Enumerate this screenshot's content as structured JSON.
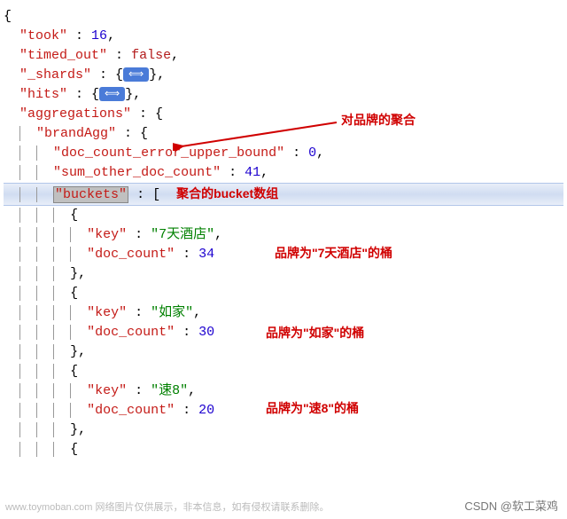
{
  "json": {
    "took_key": "\"took\"",
    "took_val": "16",
    "timed_out_key": "\"timed_out\"",
    "timed_out_val": "false",
    "shards_key": "\"_shards\"",
    "hits_key": "\"hits\"",
    "aggregations_key": "\"aggregations\"",
    "brandAgg_key": "\"brandAgg\"",
    "doc_count_error_key": "\"doc_count_error_upper_bound\"",
    "doc_count_error_val": "0",
    "sum_other_key": "\"sum_other_doc_count\"",
    "sum_other_val": "41",
    "buckets_key": "\"buckets\"",
    "key_label": "\"key\"",
    "doc_count_label": "\"doc_count\"",
    "bucket1_key": "\"7天酒店\"",
    "bucket1_count": "34",
    "bucket2_key": "\"如家\"",
    "bucket2_count": "30",
    "bucket3_key": "\"速8\"",
    "bucket3_count": "20"
  },
  "badge": "⟺",
  "annotations": {
    "brand_agg": "对品牌的聚合",
    "bucket_array": "聚合的bucket数组",
    "bucket1": "品牌为\"7天酒店\"的桶",
    "bucket2": "品牌为\"如家\"的桶",
    "bucket3": "品牌为\"速8\"的桶"
  },
  "watermarks": {
    "bottom_left": "www.toymoban.com 网络图片仅供展示，非本信息，如有侵权请联系删除。",
    "bottom_right": "CSDN @软工菜鸡"
  },
  "chart_data": {
    "type": "table",
    "title": "Elasticsearch aggregation response (buckets)",
    "columns": [
      "key",
      "doc_count"
    ],
    "rows": [
      [
        "7天酒店",
        34
      ],
      [
        "如家",
        30
      ],
      [
        "速8",
        20
      ]
    ],
    "meta": {
      "took": 16,
      "timed_out": false,
      "doc_count_error_upper_bound": 0,
      "sum_other_doc_count": 41,
      "aggregation_name": "brandAgg"
    }
  }
}
